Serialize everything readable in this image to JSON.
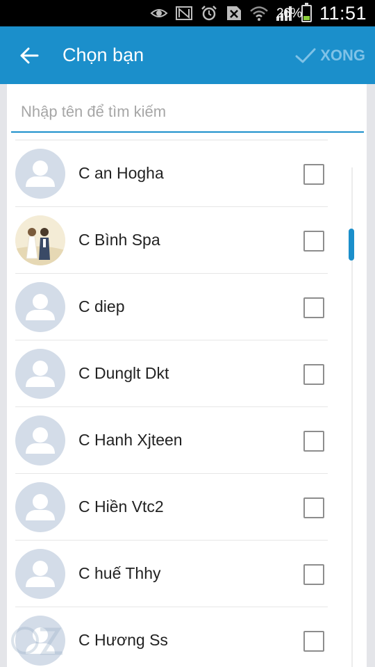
{
  "status_bar": {
    "icons": [
      "eye-icon",
      "nfc-icon",
      "alarm-icon",
      "no-sim-icon",
      "wifi-icon",
      "signal-icon"
    ],
    "battery": "26%",
    "time": "11:51"
  },
  "app_bar": {
    "back_icon": "arrow-left-icon",
    "title": "Chọn bạn",
    "done_label": "XONG",
    "done_icon": "check-icon",
    "color": "#1b8fcb"
  },
  "search": {
    "placeholder": "Nhập tên để tìm kiếm",
    "value": ""
  },
  "contacts": [
    {
      "name": "C an Hogha",
      "avatar": "default",
      "checked": false
    },
    {
      "name": "C Bình Spa",
      "avatar": "photo",
      "checked": false
    },
    {
      "name": "C diep",
      "avatar": "default",
      "checked": false
    },
    {
      "name": "C Dunglt Dkt",
      "avatar": "default",
      "checked": false
    },
    {
      "name": "C Hanh Xjteen",
      "avatar": "default",
      "checked": false
    },
    {
      "name": "C Hiền Vtc2",
      "avatar": "default",
      "checked": false
    },
    {
      "name": "C huế Thhy",
      "avatar": "default",
      "checked": false
    },
    {
      "name": "C Hương Ss",
      "avatar": "default",
      "checked": false
    }
  ]
}
